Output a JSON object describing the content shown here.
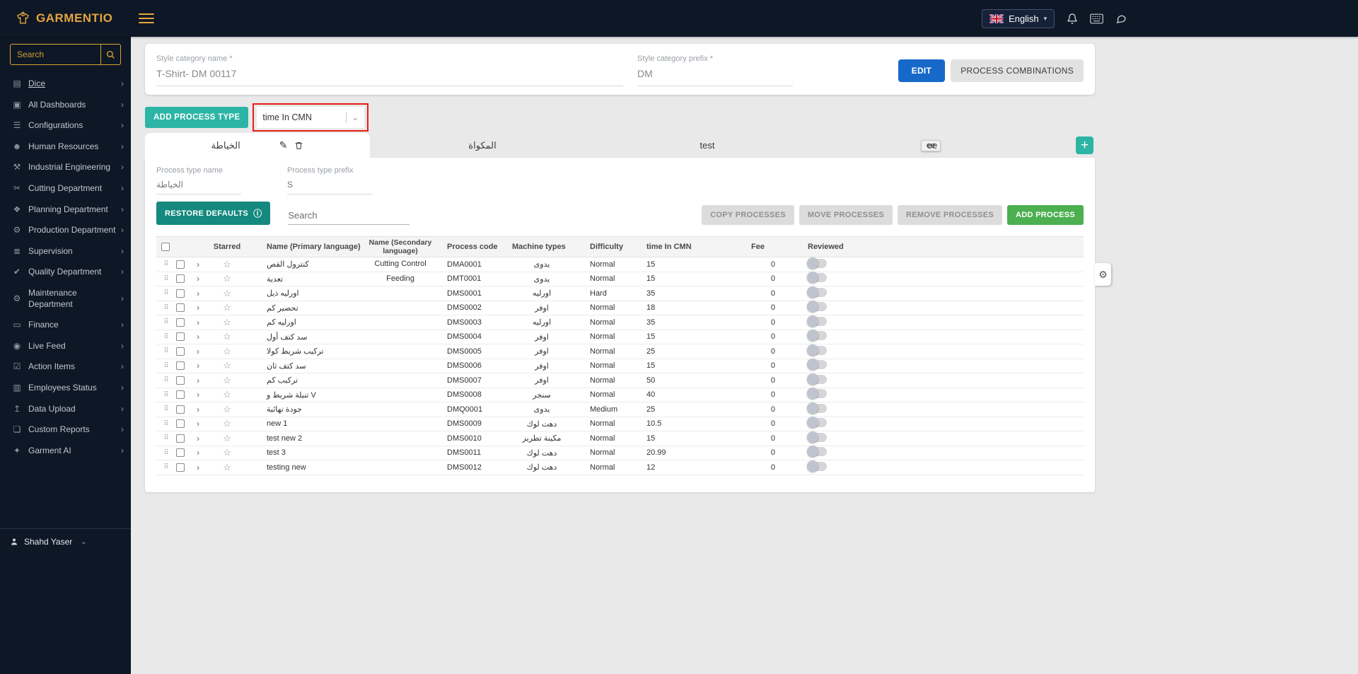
{
  "topbar": {
    "brand": "GARMENTIO",
    "language": "English",
    "icons": [
      "bell-icon",
      "keyboard-icon",
      "chat-icon"
    ]
  },
  "sidebar": {
    "search_placeholder": "Search",
    "items": [
      {
        "label": "Dice",
        "icon": "chart-icon"
      },
      {
        "label": "All Dashboards",
        "icon": "dashboards-icon"
      },
      {
        "label": "Configurations",
        "icon": "configurations-icon"
      },
      {
        "label": "Human Resources",
        "icon": "people-icon"
      },
      {
        "label": "Industrial Engineering",
        "icon": "factory-icon"
      },
      {
        "label": "Cutting Department",
        "icon": "scissors-icon"
      },
      {
        "label": "Planning Department",
        "icon": "planning-icon"
      },
      {
        "label": "Production Department",
        "icon": "production-icon"
      },
      {
        "label": "Supervision",
        "icon": "supervision-icon"
      },
      {
        "label": "Quality Department",
        "icon": "quality-icon"
      },
      {
        "label": "Maintenance Department",
        "icon": "maintenance-icon"
      },
      {
        "label": "Finance",
        "icon": "finance-icon"
      },
      {
        "label": "Live Feed",
        "icon": "live-feed-icon"
      },
      {
        "label": "Action Items",
        "icon": "action-items-icon"
      },
      {
        "label": "Employees Status",
        "icon": "employees-icon"
      },
      {
        "label": "Data Upload",
        "icon": "upload-icon"
      },
      {
        "label": "Custom Reports",
        "icon": "reports-icon"
      },
      {
        "label": "Garment AI",
        "icon": "garment-ai-icon"
      }
    ],
    "user": "Shahd Yaser"
  },
  "style_card": {
    "name_label": "Style category name *",
    "name_value": "T-Shirt- DM 00117",
    "prefix_label": "Style category prefix *",
    "prefix_value": "DM",
    "edit_label": "EDIT",
    "combinations_label": "PROCESS COMBINATIONS"
  },
  "process_bar": {
    "add_type_label": "ADD PROCESS TYPE",
    "metric_dropdown": "time In CMN",
    "floating_badge": "ee"
  },
  "tabs": {
    "items": [
      "الخياطة",
      "المكواة",
      "test",
      "ee"
    ],
    "active_index": 0
  },
  "panel": {
    "name_label": "Process type name",
    "name_value": "الخياطة",
    "prefix_label": "Process type prefix",
    "prefix_value": "S",
    "restore_label": "RESTORE DEFAULTS",
    "search_label": "Search",
    "copy_label": "COPY PROCESSES",
    "move_label": "MOVE PROCESSES",
    "remove_label": "REMOVE PROCESSES",
    "add_label": "ADD PROCESS"
  },
  "table": {
    "headers": [
      "Starred",
      "Name (Primary language)",
      "Name (Secondary language)",
      "Process code",
      "Machine types",
      "Difficulty",
      "time In CMN",
      "Fee",
      "Reviewed"
    ],
    "rows": [
      {
        "name_primary": "كنترول القص",
        "name_secondary": "Cutting Control",
        "code": "DMA0001",
        "machine": "يدوى",
        "difficulty": "Normal",
        "time": "15",
        "fee": "0"
      },
      {
        "name_primary": "تعدية",
        "name_secondary": "Feeding",
        "code": "DMT0001",
        "machine": "يدوى",
        "difficulty": "Normal",
        "time": "15",
        "fee": "0"
      },
      {
        "name_primary": "اورليه ذيل",
        "name_secondary": "",
        "code": "DMS0001",
        "machine": "اورليه",
        "difficulty": "Hard",
        "time": "35",
        "fee": "0"
      },
      {
        "name_primary": "تحضير كم",
        "name_secondary": "",
        "code": "DMS0002",
        "machine": "اوفر",
        "difficulty": "Normal",
        "time": "18",
        "fee": "0"
      },
      {
        "name_primary": "اورليه كم",
        "name_secondary": "",
        "code": "DMS0003",
        "machine": "اورليه",
        "difficulty": "Normal",
        "time": "35",
        "fee": "0"
      },
      {
        "name_primary": "سد كتف أول",
        "name_secondary": "",
        "code": "DMS0004",
        "machine": "اوفر",
        "difficulty": "Normal",
        "time": "15",
        "fee": "0"
      },
      {
        "name_primary": "تركيب شريط كولا",
        "name_secondary": "",
        "code": "DMS0005",
        "machine": "اوفر",
        "difficulty": "Normal",
        "time": "25",
        "fee": "0"
      },
      {
        "name_primary": "سد كتف ثان",
        "name_secondary": "",
        "code": "DMS0006",
        "machine": "اوفر",
        "difficulty": "Normal",
        "time": "15",
        "fee": "0"
      },
      {
        "name_primary": "تركيب كم",
        "name_secondary": "",
        "code": "DMS0007",
        "machine": "اوفر",
        "difficulty": "Normal",
        "time": "50",
        "fee": "0"
      },
      {
        "name_primary": "تنيلة شريط و V",
        "name_secondary": "",
        "code": "DMS0008",
        "machine": "سنجر",
        "difficulty": "Normal",
        "time": "40",
        "fee": "0"
      },
      {
        "name_primary": "جودة نهائية",
        "name_secondary": "",
        "code": "DMQ0001",
        "machine": "يدوى",
        "difficulty": "Medium",
        "time": "25",
        "fee": "0"
      },
      {
        "name_primary": "new 1",
        "name_secondary": "",
        "code": "DMS0009",
        "machine": "دهت لوك",
        "difficulty": "Normal",
        "time": "10.5",
        "fee": "0"
      },
      {
        "name_primary": "test new 2",
        "name_secondary": "",
        "code": "DMS0010",
        "machine": "مكينة تطريز",
        "difficulty": "Normal",
        "time": "15",
        "fee": "0"
      },
      {
        "name_primary": "test 3",
        "name_secondary": "",
        "code": "DMS0011",
        "machine": "دهت لوك",
        "difficulty": "Normal",
        "time": "20.99",
        "fee": "0"
      },
      {
        "name_primary": "testing new",
        "name_secondary": "",
        "code": "DMS0012",
        "machine": "دهت لوك",
        "difficulty": "Normal",
        "time": "12",
        "fee": "0"
      }
    ]
  }
}
